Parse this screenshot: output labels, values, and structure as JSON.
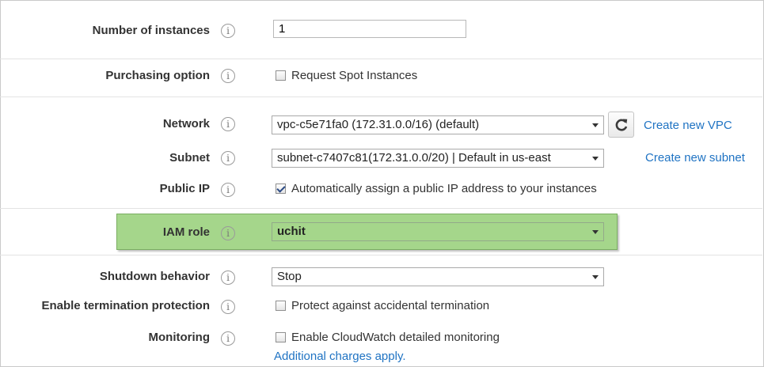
{
  "rows": {
    "instances": {
      "label": "Number of instances",
      "value": "1"
    },
    "purchasing": {
      "label": "Purchasing option",
      "checkbox_label": "Request Spot Instances",
      "checked": false
    },
    "network": {
      "label": "Network",
      "selected": "vpc-c5e71fa0 (172.31.0.0/16) (default)",
      "link": "Create new VPC"
    },
    "subnet": {
      "label": "Subnet",
      "selected": "subnet-c7407c81(172.31.0.0/20) | Default in us-east",
      "link": "Create new subnet"
    },
    "public_ip": {
      "label": "Public IP",
      "checkbox_label": "Automatically assign a public IP address to your instances",
      "checked": true
    },
    "iam_role": {
      "label": "IAM role",
      "selected": "uchit",
      "highlight_color": "#a5d68b"
    },
    "shutdown": {
      "label": "Shutdown behavior",
      "selected": "Stop"
    },
    "termination": {
      "label": "Enable termination protection",
      "checkbox_label": "Protect against accidental termination",
      "checked": false
    },
    "monitoring": {
      "label": "Monitoring",
      "checkbox_label": "Enable CloudWatch detailed monitoring",
      "checked": false,
      "note": "Additional charges apply."
    }
  },
  "icons": {
    "info": "info-icon",
    "refresh": "refresh-icon"
  },
  "info_glyph": "i",
  "colors": {
    "link": "#1f73c3",
    "highlight": "#a5d68b"
  }
}
